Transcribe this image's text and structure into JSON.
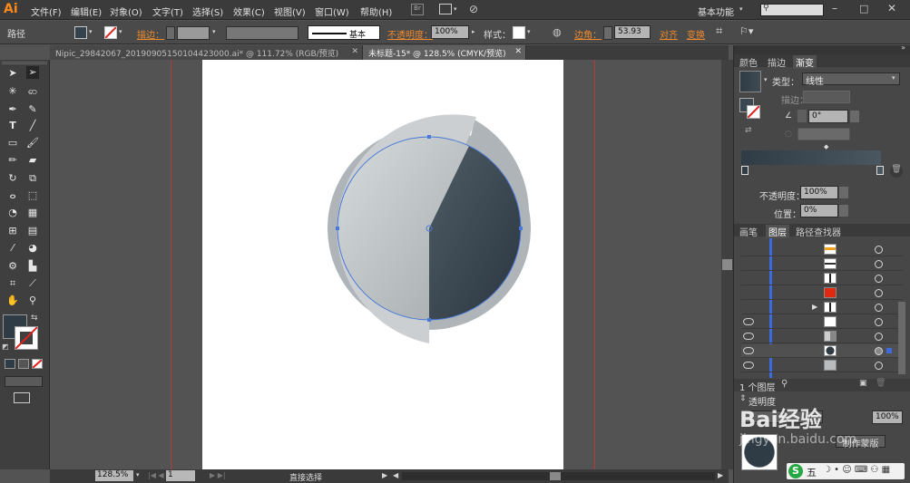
{
  "app": {
    "logo": "Ai"
  },
  "menu": [
    "文件(F)",
    "编辑(E)",
    "对象(O)",
    "文字(T)",
    "选择(S)",
    "效果(C)",
    "视图(V)",
    "窗口(W)",
    "帮助(H)"
  ],
  "workspace": {
    "label": "基本功能"
  },
  "control": {
    "selection_label": "路径",
    "stroke_label": "描边：",
    "stroke_style": "基本",
    "opacity_label": "不透明度：",
    "opacity_value": "100%",
    "style_label": "样式：",
    "corner_label": "边角：",
    "corner_value": "53.93",
    "align_label": "对齐",
    "transform_label": "变换"
  },
  "tabs": [
    {
      "label": "Nipic_29842067_20190905150104423000.ai* @ 111.72% (RGB/预览)",
      "active": false
    },
    {
      "label": "未标题-15* @ 128.5% (CMYK/预览)",
      "active": true
    }
  ],
  "status": {
    "zoom": "128.5%",
    "page": "1",
    "tool": "直接选择"
  },
  "gradient_panel": {
    "tabs": [
      "颜色",
      "描边",
      "渐变"
    ],
    "type_label": "类型：",
    "type_value": "线性",
    "stroke_label": "描边：",
    "angle_value": "0°",
    "opacity_label": "不透明度：",
    "opacity_value": "100%",
    "position_label": "位置：",
    "position_value": "0%"
  },
  "layers_panel": {
    "tabs": [
      "画笔",
      "图层",
      "路径查找器"
    ],
    "count_label": "1 个图层"
  },
  "transparency_panel": {
    "title": "透明度",
    "opacity_value": "100%",
    "mask_button": "制作蒙版"
  },
  "watermark": {
    "text": "Bai经验",
    "url": "jingyan.baidu.com"
  },
  "ime": {
    "label": "五"
  },
  "colors": {
    "accent": "#ef8b2d",
    "dark_fill": "#2f3b45",
    "guide": "#b23b36"
  }
}
